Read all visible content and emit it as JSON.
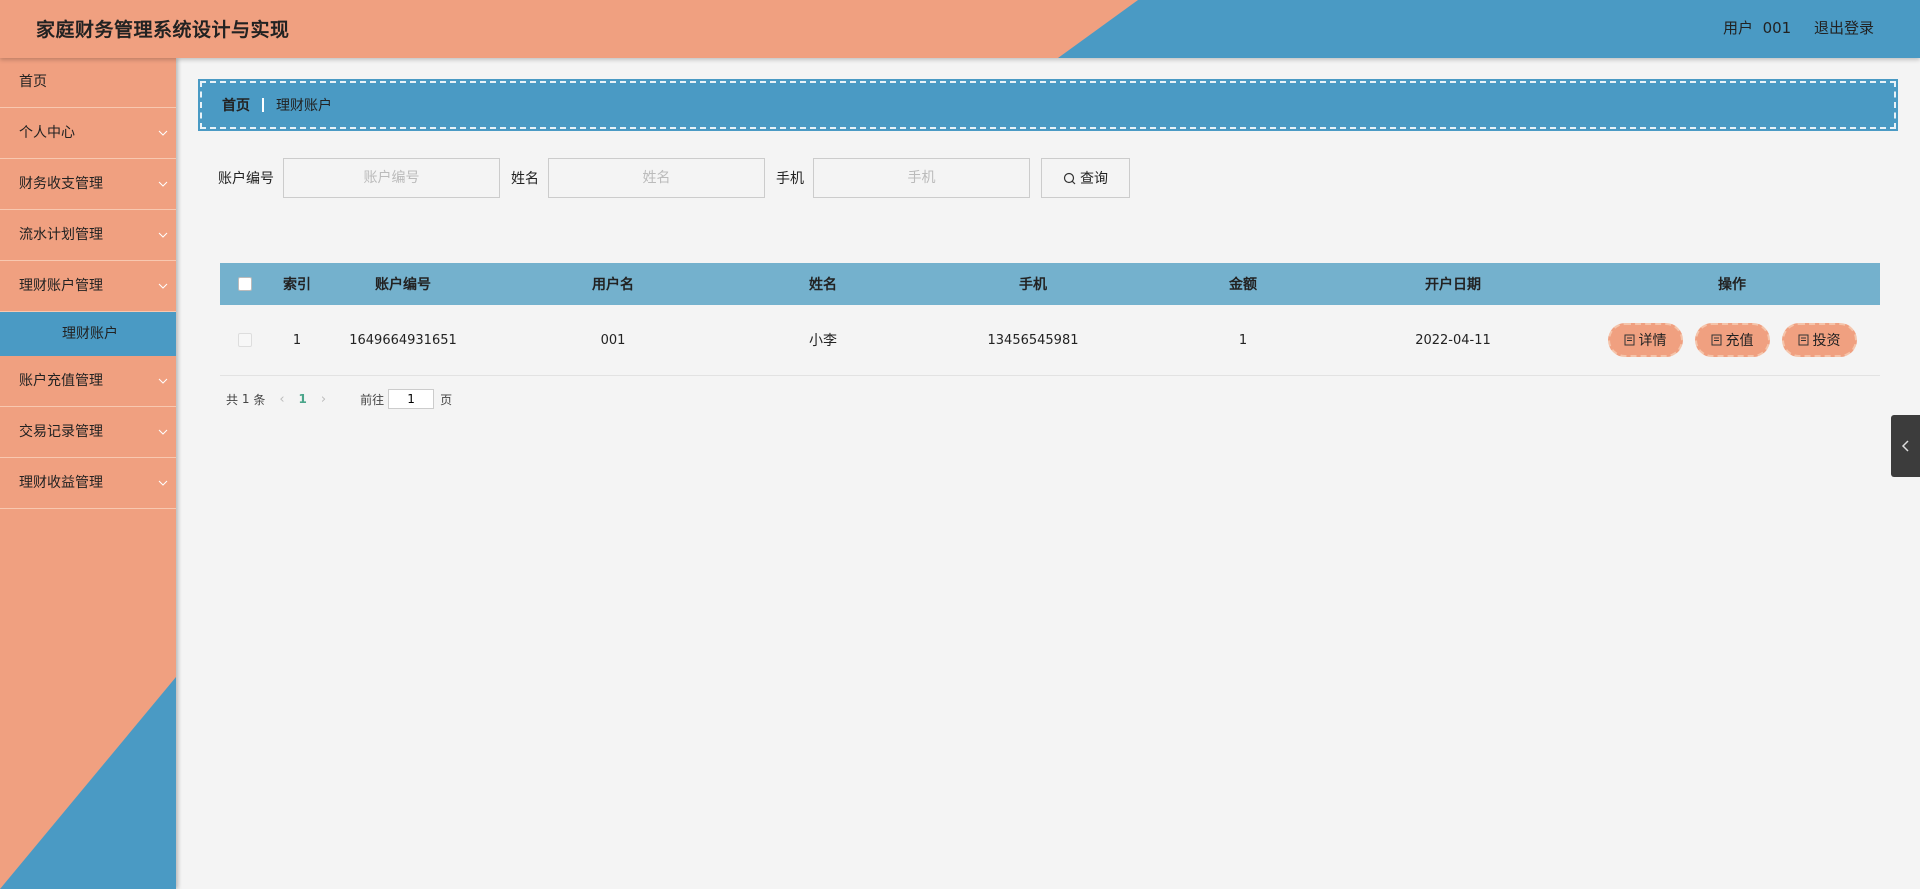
{
  "app": {
    "title": "家庭财务管理系统设计与实现"
  },
  "header": {
    "user_label": "用户",
    "user_name": "001",
    "logout_label": "退出登录"
  },
  "sidebar": {
    "items": [
      {
        "label": "首页",
        "has_children": false
      },
      {
        "label": "个人中心",
        "has_children": true
      },
      {
        "label": "财务收支管理",
        "has_children": true
      },
      {
        "label": "流水计划管理",
        "has_children": true
      },
      {
        "label": "理财账户管理",
        "has_children": true,
        "expanded": true
      },
      {
        "label": "理财账户",
        "sub": true,
        "active": true
      },
      {
        "label": "账户充值管理",
        "has_children": true
      },
      {
        "label": "交易记录管理",
        "has_children": true
      },
      {
        "label": "理财收益管理",
        "has_children": true
      }
    ]
  },
  "breadcrumb": {
    "home": "首页",
    "current": "理财账户"
  },
  "search": {
    "account_label": "账户编号",
    "account_placeholder": "账户编号",
    "name_label": "姓名",
    "name_placeholder": "姓名",
    "phone_label": "手机",
    "phone_placeholder": "手机",
    "query_button": "查询"
  },
  "table": {
    "columns": [
      "索引",
      "账户编号",
      "用户名",
      "姓名",
      "手机",
      "金额",
      "开户日期",
      "操作"
    ],
    "rows": [
      {
        "index": "1",
        "account_no": "1649664931651",
        "username": "001",
        "name": "小李",
        "phone": "13456545981",
        "amount": "1",
        "open_date": "2022-04-11",
        "actions": [
          "详情",
          "充值",
          "投资"
        ]
      }
    ]
  },
  "pagination": {
    "total_prefix": "共",
    "total": "1",
    "total_suffix": "条",
    "current_page": "1",
    "goto_label": "前往",
    "goto_value": "1",
    "goto_suffix": "页"
  },
  "colors": {
    "salmon": "#f0a080",
    "blue": "#4a9ac4",
    "table_header": "#74b1cd",
    "background": "#f4f4f4"
  }
}
